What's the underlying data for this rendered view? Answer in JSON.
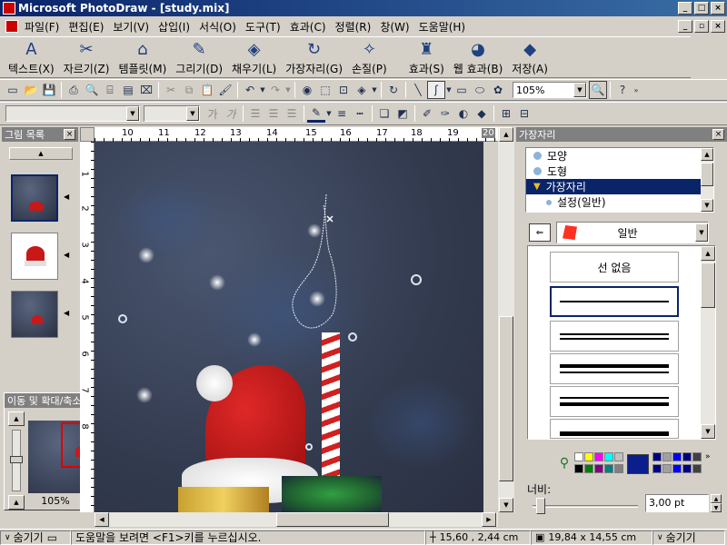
{
  "window": {
    "title": "Microsoft PhotoDraw - [study.mix]"
  },
  "menu": [
    "파일(F)",
    "편집(E)",
    "보기(V)",
    "삽입(I)",
    "서식(O)",
    "도구(T)",
    "효과(C)",
    "정렬(R)",
    "창(W)",
    "도움말(H)"
  ],
  "visual_toolbar": [
    {
      "label": "텍스트(X)",
      "icon": "A"
    },
    {
      "label": "자르기(Z)",
      "icon": "✂"
    },
    {
      "label": "템플릿(M)",
      "icon": "⌂"
    },
    {
      "label": "그리기(D)",
      "icon": "✎"
    },
    {
      "label": "채우기(L)",
      "icon": "◈"
    },
    {
      "label": "가장자리(G)",
      "icon": "↻"
    },
    {
      "label": "손질(P)",
      "icon": "✧"
    },
    {
      "label": "효과(S)",
      "icon": "♜"
    },
    {
      "label": "웹 효과(B)",
      "icon": "◕"
    },
    {
      "label": "저장(A)",
      "icon": "◆"
    }
  ],
  "standard_toolbar": {
    "zoom_value": "105%"
  },
  "picture_list": {
    "title": "그림 목록"
  },
  "pan_zoom": {
    "title": "이동 및 확대/축소",
    "zoom": "105%"
  },
  "ruler": {
    "h_ticks": [
      "10",
      "11",
      "12",
      "13",
      "14",
      "15",
      "16",
      "17",
      "18",
      "19",
      "20"
    ],
    "v_ticks": [
      "1",
      "2",
      "3",
      "4",
      "5",
      "6",
      "7",
      "8"
    ]
  },
  "right_panel": {
    "title": "가장자리",
    "tree": [
      "모양",
      "도형",
      "가장자리",
      "설정(일반)"
    ],
    "category": "일반",
    "no_line": "선 없음",
    "width_label": "너비:",
    "width_value": "3,00 pt"
  },
  "palette": [
    "#ffffff",
    "#ffff00",
    "#ff00ff",
    "#00ffff",
    "#c0c0c0",
    "#000000",
    "#008000",
    "#800080",
    "#008080",
    "#808080",
    "#000080",
    "#a0a0a0",
    "#0000ff",
    "#000080",
    "#404040"
  ],
  "status": {
    "hide1": "숨기기",
    "help": "도움말을 보려면 <F1>키를 누르십시오.",
    "pos": "15,60 , 2,44  cm",
    "size": "19,84 x 14,55  cm",
    "hide2": "숨기기"
  },
  "colors": {
    "title_start": "#0a246a",
    "title_end": "#3a6ea5",
    "selection": "#0a246a",
    "hat_red": "#c81818"
  }
}
